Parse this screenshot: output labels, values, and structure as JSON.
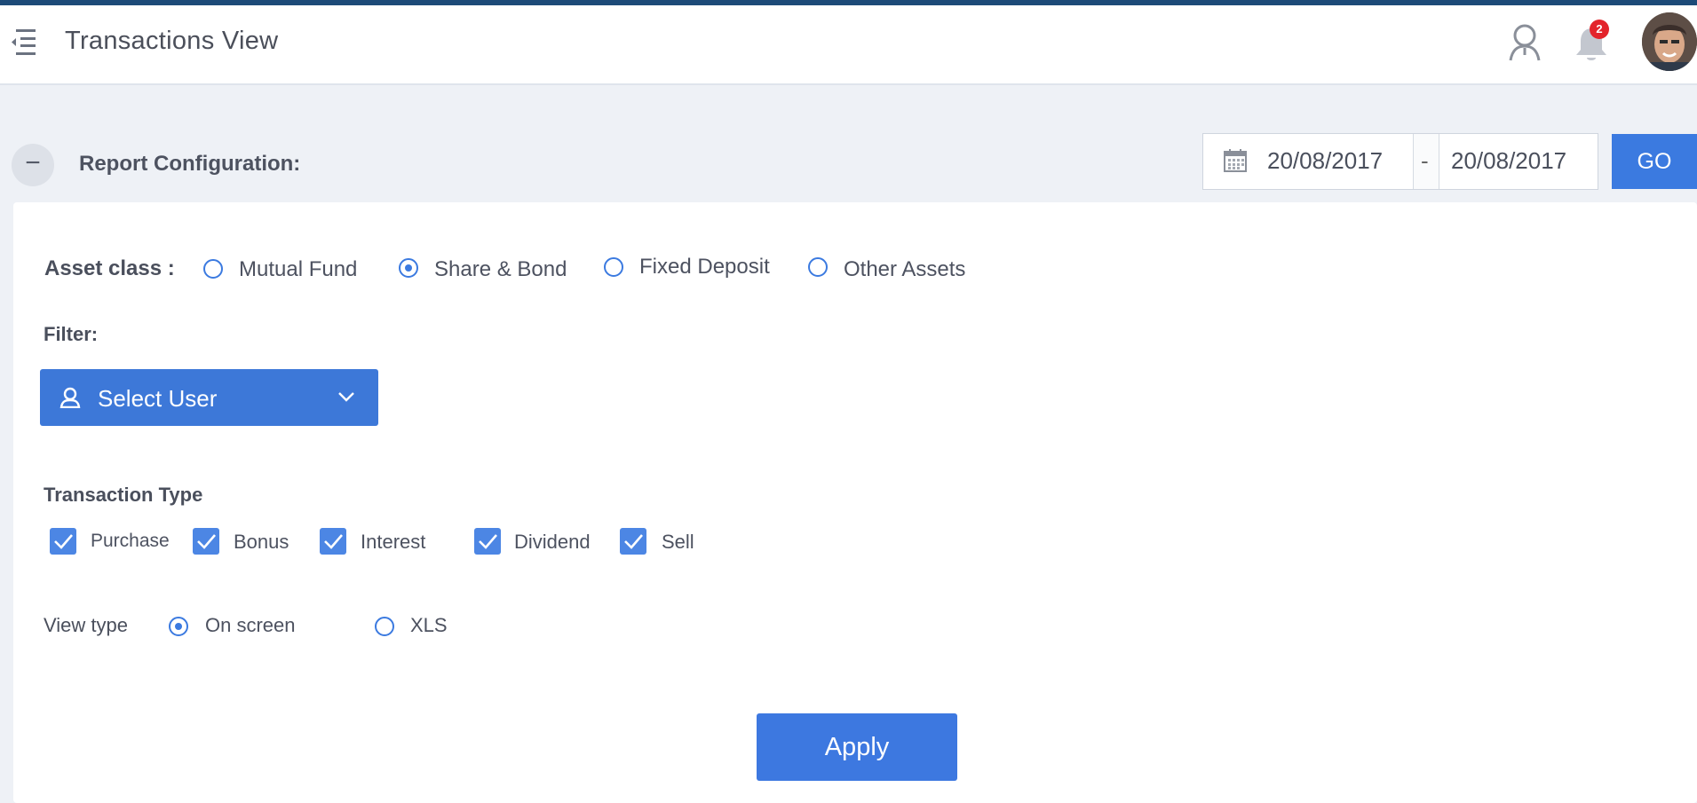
{
  "header": {
    "title": "Transactions View",
    "notification_count": "2"
  },
  "report": {
    "section_title": "Report Configuration:",
    "collapse_symbol": "−",
    "date_from": "20/08/2017",
    "date_separator": "-",
    "date_to": "20/08/2017",
    "go_label": "GO"
  },
  "asset_class": {
    "label": "Asset class :",
    "options": [
      "Mutual Fund",
      "Share & Bond",
      "Fixed Deposit",
      "Other Assets"
    ],
    "selected": "Share & Bond"
  },
  "filter": {
    "label": "Filter:",
    "select_user_label": "Select User"
  },
  "transaction_type": {
    "label": "Transaction Type",
    "options": [
      "Purchase",
      "Bonus",
      "Interest",
      "Dividend",
      "Sell"
    ],
    "checked": [
      true,
      true,
      true,
      true,
      true
    ]
  },
  "view_type": {
    "label": "View type",
    "options": [
      "On screen",
      "XLS"
    ],
    "selected": "On screen"
  },
  "apply_label": "Apply",
  "colors": {
    "accent": "#3b7ae0",
    "badge": "#e3242b",
    "top_strip": "#1d4a78"
  },
  "icons": {
    "menu": "menu-collapse-icon",
    "user": "user-icon",
    "bell": "bell-icon",
    "calendar": "calendar-icon",
    "chevron": "chevron-down-icon"
  }
}
